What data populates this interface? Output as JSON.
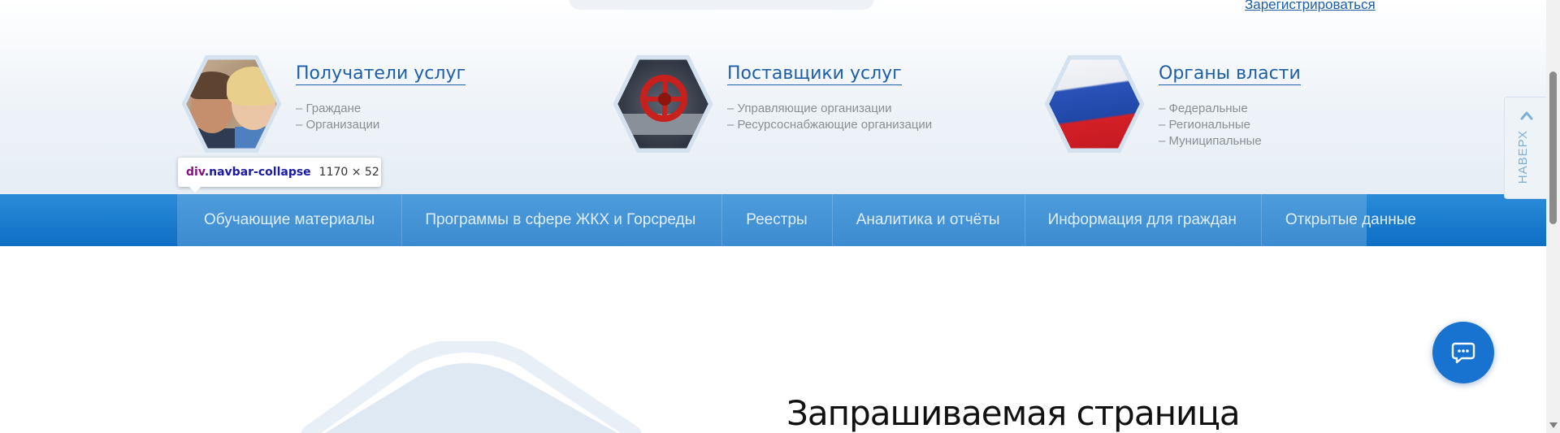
{
  "header": {
    "register_link": "Зарегистрироваться"
  },
  "categories": [
    {
      "title": "Получатели услуг",
      "image": "people-photo",
      "items": [
        "– Граждане",
        "– Организации"
      ]
    },
    {
      "title": "Поставщики услуг",
      "image": "valve-photo",
      "items": [
        "– Управляющие организации",
        "– Ресурсоснабжающие организации"
      ]
    },
    {
      "title": "Органы власти",
      "image": "russian-flag-photo",
      "items": [
        "– Федеральные",
        "– Региональные",
        "– Муниципальные"
      ]
    }
  ],
  "navbar": {
    "items": [
      "Обучающие материалы",
      "Программы в сфере ЖКХ и Горсреды",
      "Реестры",
      "Аналитика и отчёты",
      "Информация для граждан",
      "Открытые данные"
    ]
  },
  "devtools_tooltip": {
    "tag": "div",
    "class": ".navbar-collapse",
    "dimensions": "1170 × 52"
  },
  "back_to_top": {
    "label": "НАВЕРХ",
    "icon": "chevron-up-icon"
  },
  "chat": {
    "icon": "chat-bubble-icon"
  },
  "main": {
    "heading": "Запрашиваемая страница"
  },
  "colors": {
    "link_blue": "#1c5fa8",
    "nav_blue": "#0e6fc4",
    "chat_blue": "#1773cf"
  }
}
